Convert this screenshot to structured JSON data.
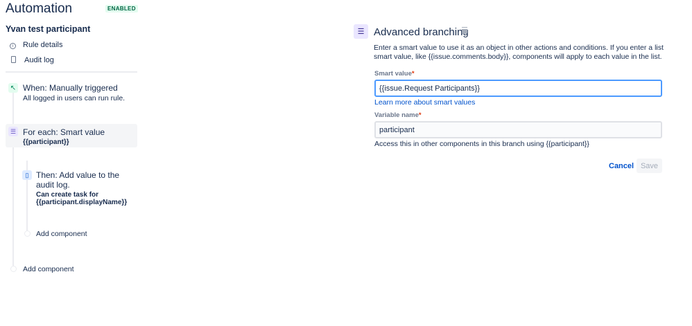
{
  "header": {
    "title": "Automation",
    "status": "ENABLED"
  },
  "sidebar": {
    "rule_name": "Yvan test participant",
    "items": [
      {
        "label": "Rule details",
        "icon": "info-icon"
      },
      {
        "label": "Audit log",
        "icon": "audit-log-icon"
      }
    ]
  },
  "flow": {
    "trigger": {
      "title": "When: Manually triggered",
      "subtitle": "All logged in users can run rule.",
      "icon": "manual-trigger-icon"
    },
    "branch": {
      "title": "For each: Smart value",
      "value": "{{participant}}",
      "icon": "branch-list-icon"
    },
    "action": {
      "title_line1": "Then: Add value to the",
      "title_line2": "audit log.",
      "detail_line1": "Can create task for",
      "detail_line2": "{{participant.displayName}}",
      "icon": "audit-log-icon"
    },
    "add_inner": "Add component",
    "add_outer": "Add component"
  },
  "panel": {
    "title": "Advanced branching",
    "description": "Enter a smart value to use it as an object in other actions and conditions. If you enter a list smart value, like {{issue.comments.body}}, components will apply to each value in the list.",
    "smart_value_label": "Smart value",
    "smart_value": "{{issue.Request Participants}}",
    "learn_more": "Learn more about smart values",
    "variable_label": "Variable name",
    "variable_value": "participant",
    "variable_help": "Access this in other components in this branch using {{participant}}",
    "required_mark": "*",
    "cancel": "Cancel",
    "save": "Save"
  },
  "colors": {
    "accent": "#0052cc",
    "input_focus": "#4c9aff",
    "enabled_bg": "#e3fcef",
    "enabled_text": "#006644"
  }
}
